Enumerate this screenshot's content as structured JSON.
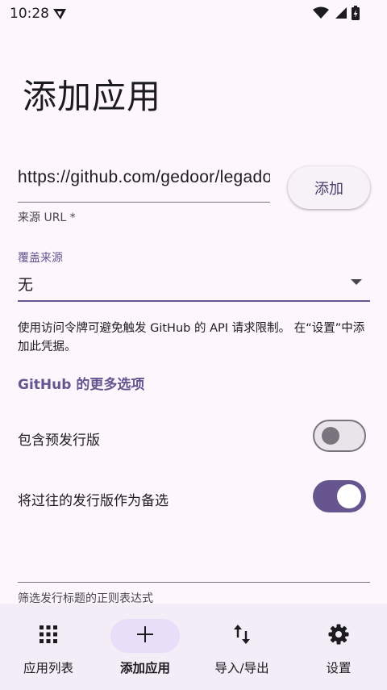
{
  "status_bar": {
    "time": "10:28",
    "icons": [
      "app-notification-icon",
      "wifi-icon",
      "signal-icon",
      "battery-charging-icon"
    ]
  },
  "page": {
    "title": "添加应用"
  },
  "source_url": {
    "value": "https://github.com/gedoor/legado",
    "helper": "来源 URL *"
  },
  "add_button": {
    "label": "添加"
  },
  "override_source": {
    "label": "覆盖来源",
    "value": "无"
  },
  "info_text": "使用访问令牌可避免触发 GitHub 的 API 请求限制。 在“设置”中添加此凭据。",
  "github_section": {
    "title": "GitHub 的更多选项"
  },
  "settings": [
    {
      "label": "包含预发行版",
      "enabled": false
    },
    {
      "label": "将过往的发行版作为备选",
      "enabled": true
    }
  ],
  "regex_filter": {
    "value": "",
    "helper": "筛选发行标题的正则表达式"
  },
  "bottom_nav": [
    {
      "label": "应用列表",
      "icon": "apps-grid-icon",
      "active": false
    },
    {
      "label": "添加应用",
      "icon": "plus-icon",
      "active": true
    },
    {
      "label": "导入/导出",
      "icon": "swap-vertical-icon",
      "active": false
    },
    {
      "label": "设置",
      "icon": "gear-icon",
      "active": false
    }
  ],
  "colors": {
    "accent": "#67558f",
    "background": "#fdf7fd",
    "nav_bg": "#f3edf7",
    "active_indicator": "#e8def8"
  }
}
